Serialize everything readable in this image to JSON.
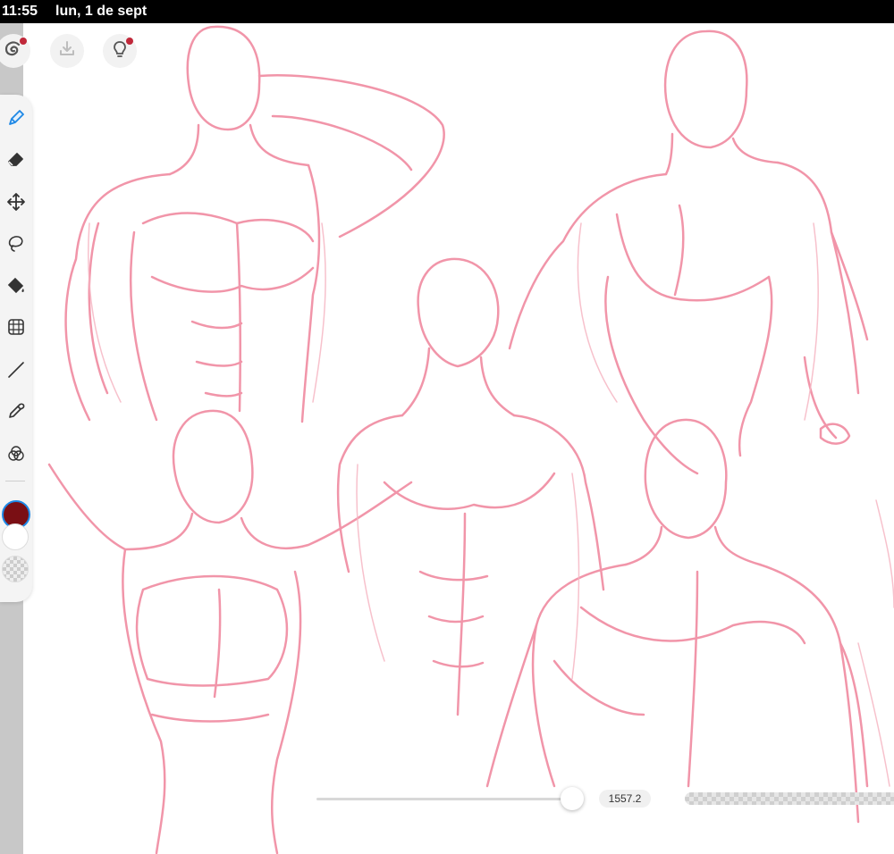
{
  "status_bar": {
    "time": "11:55",
    "date": "lun, 1 de sept"
  },
  "top_actions": [
    {
      "icon": "app-logo-icon",
      "badge": true
    },
    {
      "icon": "download-icon",
      "badge": false
    },
    {
      "icon": "lightbulb-icon",
      "badge": true
    }
  ],
  "tools": [
    {
      "icon": "pen-icon",
      "active": true
    },
    {
      "icon": "eraser-icon",
      "active": false
    },
    {
      "icon": "move-icon",
      "active": false
    },
    {
      "icon": "lasso-icon",
      "active": false
    },
    {
      "icon": "fill-bucket-icon",
      "active": false
    },
    {
      "icon": "transform-grid-icon",
      "active": false
    },
    {
      "icon": "line-icon",
      "active": false
    },
    {
      "icon": "eyedropper-icon",
      "active": false
    },
    {
      "icon": "color-blend-icon",
      "active": false
    }
  ],
  "colors": {
    "primary": "#7a0f14",
    "secondary": "#ffffff",
    "accent": "#1e88e5",
    "stroke": "#f08aa0"
  },
  "brush": {
    "size_label": "1557.2",
    "size_position": 0.97,
    "opacity_position": 0.98
  }
}
